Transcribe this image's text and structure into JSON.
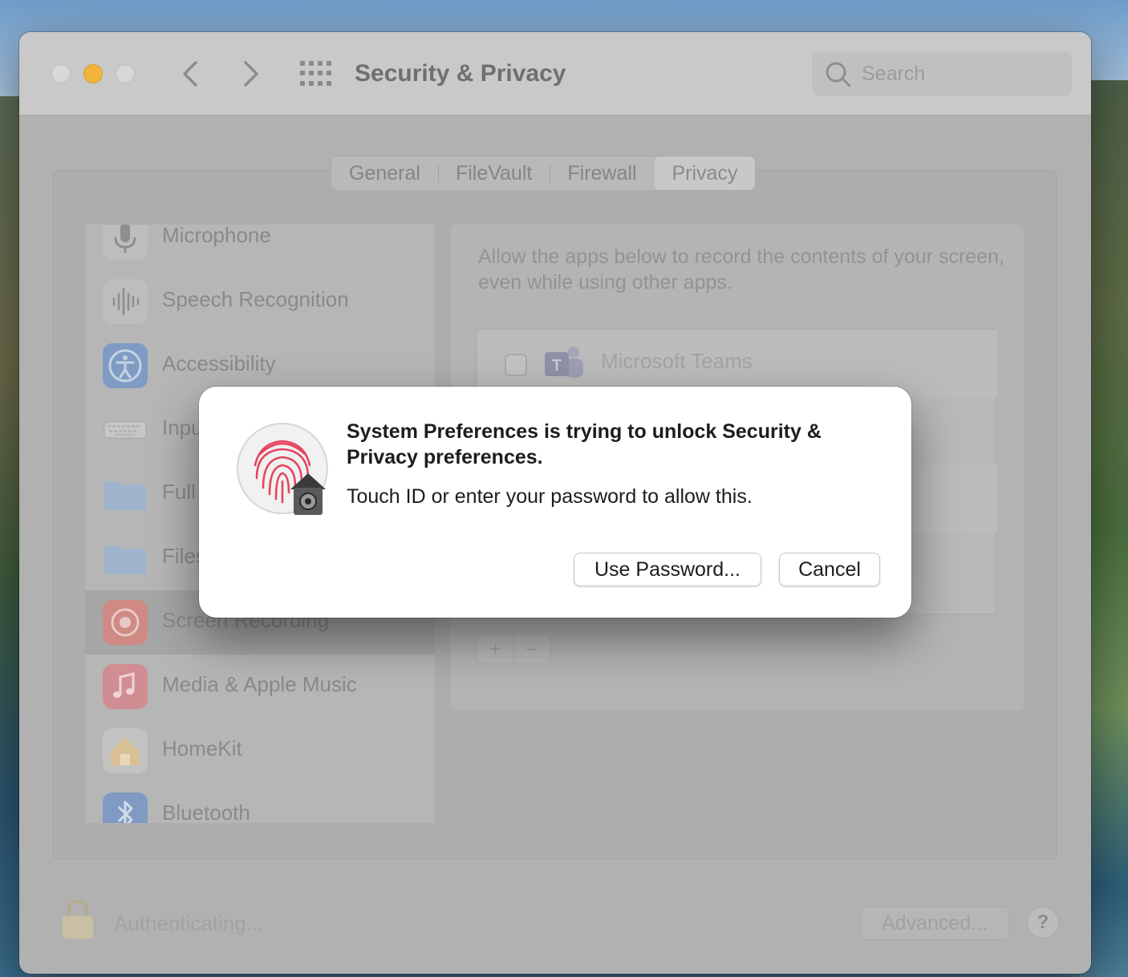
{
  "window": {
    "title": "Security & Privacy",
    "search_placeholder": "Search"
  },
  "tabs": [
    {
      "label": "General",
      "selected": false
    },
    {
      "label": "FileVault",
      "selected": false
    },
    {
      "label": "Firewall",
      "selected": false
    },
    {
      "label": "Privacy",
      "selected": true
    }
  ],
  "sidebar": {
    "items": [
      {
        "label": "Microphone",
        "icon": "microphone-icon"
      },
      {
        "label": "Speech Recognition",
        "icon": "waveform-icon"
      },
      {
        "label": "Accessibility",
        "icon": "accessibility-icon"
      },
      {
        "label": "Inpu",
        "icon": "keyboard-icon"
      },
      {
        "label": "Full",
        "icon": "folder-icon"
      },
      {
        "label": "Files",
        "icon": "folder-icon"
      },
      {
        "label": "Screen Recording",
        "icon": "screen-recording-icon",
        "selected": true
      },
      {
        "label": "Media & Apple Music",
        "icon": "music-note-icon"
      },
      {
        "label": "HomeKit",
        "icon": "home-icon"
      },
      {
        "label": "Bluetooth",
        "icon": "bluetooth-icon"
      }
    ]
  },
  "pane": {
    "description": "Allow the apps below to record the contents of your screen, even while using other apps.",
    "apps": [
      {
        "name": "Microsoft Teams",
        "checked": false,
        "icon": "teams-icon"
      }
    ],
    "add_label": "+",
    "remove_label": "−"
  },
  "footer": {
    "status": "Authenticating...",
    "advanced_label": "Advanced...",
    "help_label": "?"
  },
  "dialog": {
    "title": "System Preferences is trying to unlock Security & Privacy preferences.",
    "message": "Touch ID or enter your password to allow this.",
    "use_password_label": "Use Password...",
    "cancel_label": "Cancel",
    "icon": "touch-id-fingerprint-icon"
  },
  "colors": {
    "minimize": "#f2b43a",
    "fingerprint": "#e5465f",
    "dialog_bg": "#ffffff"
  }
}
